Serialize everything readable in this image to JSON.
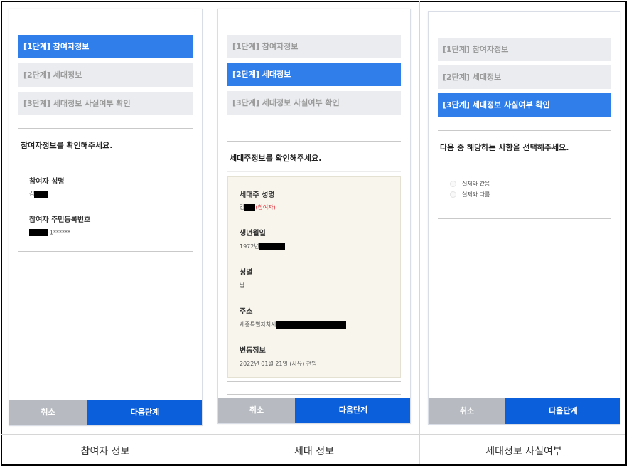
{
  "steps": [
    "[1단계] 참여자정보",
    "[2단계] 세대정보",
    "[3단계] 세대정보 사실여부 확인"
  ],
  "buttons": {
    "cancel": "취소",
    "next": "다음단계"
  },
  "screen1": {
    "active_step": 1,
    "title": "참여자정보를 확인해주세요.",
    "name_label": "참여자 성명",
    "name_value": "김",
    "id_label": "참여자 주민등록번호",
    "id_value": "-1******",
    "caption": "참여자 정보"
  },
  "screen2": {
    "active_step": 2,
    "title": "세대주정보를 확인해주세요.",
    "head_name_label": "세대주 성명",
    "head_name_value": "김",
    "head_name_note": "(참여자)",
    "birth_label": "생년월일",
    "birth_value": "1972년",
    "gender_label": "성별",
    "gender_value": "남",
    "address_label": "주소",
    "address_value": "세종특별자치시",
    "change_label": "변동정보",
    "change_value": "2022년 01월 21일 (사유) 전입",
    "caption": "세대 정보"
  },
  "screen3": {
    "active_step": 3,
    "title": "다음 중 해당하는 사항을 선택해주세요.",
    "options": [
      "실제와 같음",
      "실제와 다름"
    ],
    "caption": "세대정보 사실여부"
  }
}
